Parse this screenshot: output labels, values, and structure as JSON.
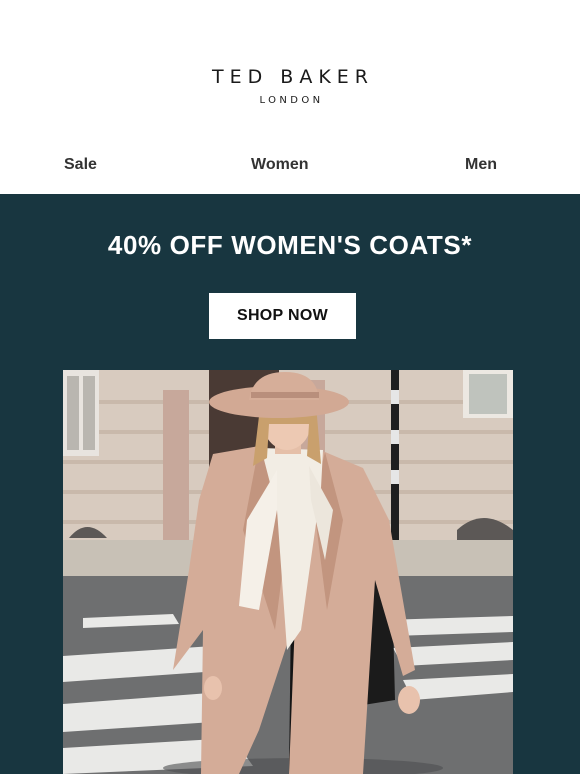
{
  "brand": {
    "name": "TED BAKER",
    "sub": "LONDON"
  },
  "nav": {
    "items": [
      {
        "label": "Sale"
      },
      {
        "label": "Women"
      },
      {
        "label": "Men"
      }
    ]
  },
  "hero": {
    "headline": "40% OFF WOMEN'S COATS*",
    "cta_label": "SHOP NOW",
    "background_color": "#183640",
    "image": {
      "kind": "photo",
      "subject": "model-in-camel-coat"
    }
  }
}
